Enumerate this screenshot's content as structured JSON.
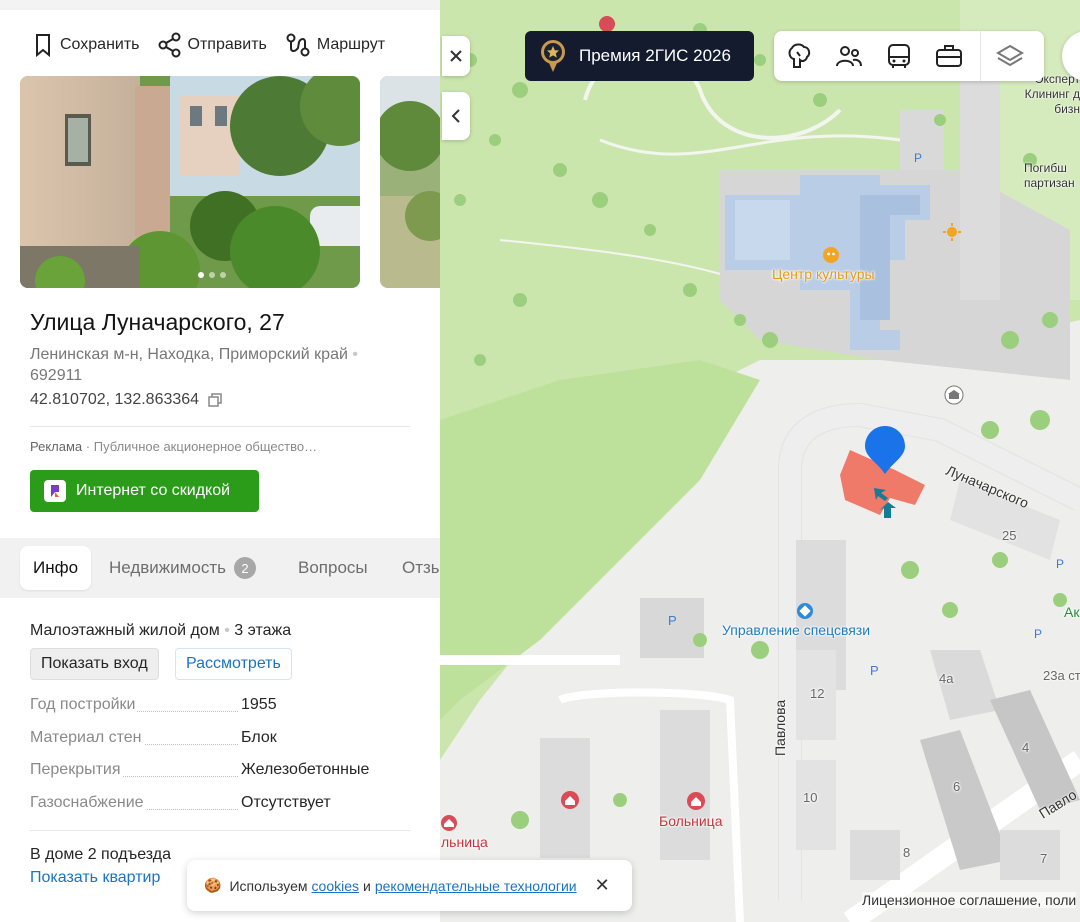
{
  "panel": {
    "actions": {
      "save": "Сохранить",
      "share": "Отправить",
      "route": "Маршрут"
    },
    "title": "Улица Луначарского, 27",
    "address_line": "Ленинская м-н, Находка, Приморский край",
    "postcode": "692911",
    "coordinates": "42.810702, 132.863364",
    "ad_label": "Реклама",
    "ad_text": "Публичное акционерное общество…",
    "ad_button": "Интернет со скидкой",
    "tabs": {
      "info": "Инфо",
      "realty": "Недвижимость",
      "realty_count": "2",
      "questions": "Вопросы",
      "reviews": "Отзы"
    },
    "house_type": "Малоэтажный жилой дом",
    "floors": "3 этажа",
    "show_entrance": "Показать вход",
    "view": "Рассмотреть",
    "properties": [
      {
        "key": "Год постройки",
        "value": "1955"
      },
      {
        "key": "Материал стен",
        "value": "Блок"
      },
      {
        "key": "Перекрытия",
        "value": "Железобетонные"
      },
      {
        "key": "Газоснабжение",
        "value": "Отсутствует"
      }
    ],
    "entrances": "В доме 2 подъезда",
    "show_apartments": "Показать квартир"
  },
  "map": {
    "award": "Премия 2ГИС 2026",
    "labels": {
      "culture_center": "Центр культуры",
      "special_comm": "Управление спецсвязи",
      "hospital": "Больница",
      "hospital_cut": "льница",
      "street_lunacharsky": "Луначарского",
      "street_pavlova": "Павлова",
      "street_pavlo": "Павло",
      "top_right": "Эксперт\nКлининг д\nбизн",
      "memorial": "Погибш\nпартизан",
      "cut_label": "Ак",
      "num_25": "25",
      "num_12": "12",
      "num_10": "10",
      "num_4a": "4а",
      "num_23a": "23а ст",
      "num_4": "4",
      "num_6": "6",
      "num_8": "8",
      "num_7": "7"
    },
    "icons": [
      "close-icon",
      "chevron-left-icon",
      "attractions-icon",
      "people-icon",
      "bus-icon",
      "briefcase-icon",
      "layers-icon"
    ],
    "pin_color": "#1a73e8",
    "building_color": "#f07a6a"
  },
  "cookie": {
    "text_before": "Используем",
    "link_cookies": "cookies",
    "text_and": "и",
    "link_tech": "рекомендательные технологии"
  },
  "license": "Лицензионное соглашение, поли"
}
